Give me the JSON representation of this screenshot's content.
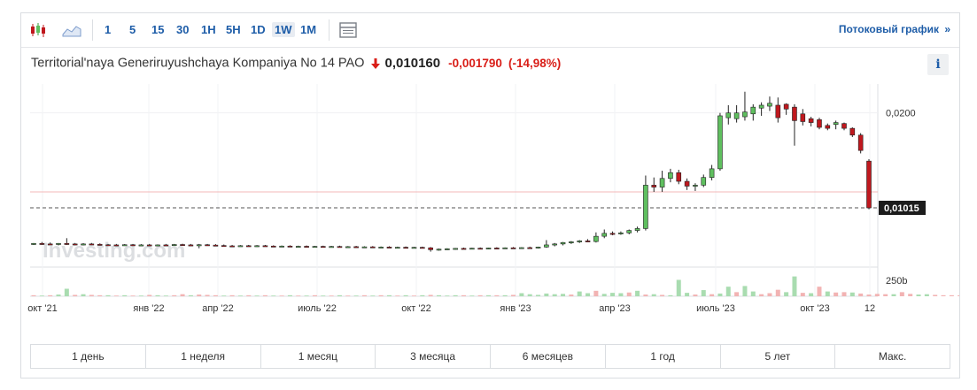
{
  "toolbar": {
    "intervals": [
      "1",
      "5",
      "15",
      "30",
      "1H",
      "5H",
      "1D",
      "1W",
      "1M"
    ],
    "active_interval": "1W",
    "stream_link": "Потоковый график",
    "stream_arrow": "»"
  },
  "header": {
    "instrument": "Territorial'naya Generiruyushchaya Kompaniya No 14 PAO",
    "last_price": "0,010160",
    "change_abs": "-0,001790",
    "change_pct": "(-14,98%)",
    "info_label": "i"
  },
  "chart": {
    "watermark": "Investing.com",
    "price_ticks": [
      "0,0200"
    ],
    "volume_tick": "250b",
    "current_price_label": "0,01015",
    "x_labels": [
      "окт '21",
      "янв '22",
      "апр '22",
      "июль '22",
      "окт '22",
      "янв '23",
      "апр '23",
      "июль '23",
      "окт '23",
      "12"
    ],
    "colors": {
      "up": "#5fbf5f",
      "down": "#c0181e",
      "up_volume": "#a9dcb0",
      "down_volume": "#f2b3b3",
      "price_line": "#c0181e"
    }
  },
  "chart_data": {
    "type": "candlestick",
    "interval": "1W",
    "y_ticks": [
      0.02
    ],
    "last_close": 0.01015,
    "x_tick_labels": [
      "окт '21",
      "янв '22",
      "апр '22",
      "июль '22",
      "окт '22",
      "янв '23",
      "апр '23",
      "июль '23",
      "окт '23",
      "12"
    ],
    "candles": [
      {
        "o": 0.0064,
        "h": 0.0065,
        "l": 0.0063,
        "c": 0.00645
      },
      {
        "o": 0.00645,
        "h": 0.0066,
        "l": 0.0063,
        "c": 0.0064
      },
      {
        "o": 0.0064,
        "h": 0.00655,
        "l": 0.0063,
        "c": 0.00638
      },
      {
        "o": 0.00638,
        "h": 0.0065,
        "l": 0.00625,
        "c": 0.00645
      },
      {
        "o": 0.00645,
        "h": 0.007,
        "l": 0.0063,
        "c": 0.0064
      },
      {
        "o": 0.0064,
        "h": 0.0065,
        "l": 0.00625,
        "c": 0.00635
      },
      {
        "o": 0.00635,
        "h": 0.00648,
        "l": 0.00625,
        "c": 0.0064
      },
      {
        "o": 0.0064,
        "h": 0.0065,
        "l": 0.00628,
        "c": 0.00636
      },
      {
        "o": 0.00636,
        "h": 0.00645,
        "l": 0.00625,
        "c": 0.00632
      },
      {
        "o": 0.00632,
        "h": 0.0064,
        "l": 0.00625,
        "c": 0.0063
      },
      {
        "o": 0.0063,
        "h": 0.0064,
        "l": 0.0062,
        "c": 0.00628
      },
      {
        "o": 0.00628,
        "h": 0.00638,
        "l": 0.0062,
        "c": 0.00632
      },
      {
        "o": 0.00632,
        "h": 0.0064,
        "l": 0.0062,
        "c": 0.00628
      },
      {
        "o": 0.00628,
        "h": 0.00638,
        "l": 0.0062,
        "c": 0.0063
      },
      {
        "o": 0.0063,
        "h": 0.0064,
        "l": 0.0062,
        "c": 0.00625
      },
      {
        "o": 0.00625,
        "h": 0.00635,
        "l": 0.00618,
        "c": 0.0063
      },
      {
        "o": 0.0063,
        "h": 0.0064,
        "l": 0.0062,
        "c": 0.00628
      },
      {
        "o": 0.00628,
        "h": 0.0064,
        "l": 0.0062,
        "c": 0.00634
      },
      {
        "o": 0.00634,
        "h": 0.00642,
        "l": 0.00625,
        "c": 0.0063
      },
      {
        "o": 0.0063,
        "h": 0.0064,
        "l": 0.0062,
        "c": 0.00628
      },
      {
        "o": 0.00628,
        "h": 0.0064,
        "l": 0.00595,
        "c": 0.00632
      },
      {
        "o": 0.00632,
        "h": 0.0064,
        "l": 0.0062,
        "c": 0.00628
      },
      {
        "o": 0.00628,
        "h": 0.00638,
        "l": 0.00618,
        "c": 0.00624
      },
      {
        "o": 0.00624,
        "h": 0.00634,
        "l": 0.00615,
        "c": 0.0062
      },
      {
        "o": 0.0062,
        "h": 0.0063,
        "l": 0.00612,
        "c": 0.00618
      },
      {
        "o": 0.00618,
        "h": 0.00628,
        "l": 0.00612,
        "c": 0.00622
      },
      {
        "o": 0.00622,
        "h": 0.0063,
        "l": 0.00612,
        "c": 0.00618
      },
      {
        "o": 0.00618,
        "h": 0.00628,
        "l": 0.0061,
        "c": 0.00622
      },
      {
        "o": 0.00622,
        "h": 0.0063,
        "l": 0.00612,
        "c": 0.00618
      },
      {
        "o": 0.00618,
        "h": 0.00626,
        "l": 0.0061,
        "c": 0.00615
      },
      {
        "o": 0.00615,
        "h": 0.00624,
        "l": 0.00608,
        "c": 0.00618
      },
      {
        "o": 0.00618,
        "h": 0.00626,
        "l": 0.0061,
        "c": 0.00614
      },
      {
        "o": 0.00614,
        "h": 0.00622,
        "l": 0.00606,
        "c": 0.00616
      },
      {
        "o": 0.00616,
        "h": 0.00624,
        "l": 0.00608,
        "c": 0.00612
      },
      {
        "o": 0.00612,
        "h": 0.0062,
        "l": 0.00606,
        "c": 0.00615
      },
      {
        "o": 0.00615,
        "h": 0.00622,
        "l": 0.00608,
        "c": 0.00612
      },
      {
        "o": 0.00612,
        "h": 0.0062,
        "l": 0.00605,
        "c": 0.00614
      },
      {
        "o": 0.00614,
        "h": 0.00622,
        "l": 0.00606,
        "c": 0.0061
      },
      {
        "o": 0.0061,
        "h": 0.00618,
        "l": 0.00604,
        "c": 0.00612
      },
      {
        "o": 0.00612,
        "h": 0.0062,
        "l": 0.00604,
        "c": 0.00608
      },
      {
        "o": 0.00608,
        "h": 0.00616,
        "l": 0.006,
        "c": 0.0061
      },
      {
        "o": 0.0061,
        "h": 0.00618,
        "l": 0.00602,
        "c": 0.00606
      },
      {
        "o": 0.00606,
        "h": 0.00614,
        "l": 0.00598,
        "c": 0.00608
      },
      {
        "o": 0.00608,
        "h": 0.00616,
        "l": 0.006,
        "c": 0.00604
      },
      {
        "o": 0.00604,
        "h": 0.00612,
        "l": 0.00596,
        "c": 0.00606
      },
      {
        "o": 0.00606,
        "h": 0.00614,
        "l": 0.00598,
        "c": 0.00603
      },
      {
        "o": 0.00603,
        "h": 0.0061,
        "l": 0.00596,
        "c": 0.00605
      },
      {
        "o": 0.00605,
        "h": 0.00612,
        "l": 0.00598,
        "c": 0.006
      },
      {
        "o": 0.006,
        "h": 0.00608,
        "l": 0.0056,
        "c": 0.0058
      },
      {
        "o": 0.0058,
        "h": 0.00592,
        "l": 0.0057,
        "c": 0.00586
      },
      {
        "o": 0.00586,
        "h": 0.00596,
        "l": 0.00576,
        "c": 0.0059
      },
      {
        "o": 0.0059,
        "h": 0.00598,
        "l": 0.0058,
        "c": 0.00594
      },
      {
        "o": 0.00594,
        "h": 0.00602,
        "l": 0.00586,
        "c": 0.00592
      },
      {
        "o": 0.00592,
        "h": 0.006,
        "l": 0.00584,
        "c": 0.00596
      },
      {
        "o": 0.00596,
        "h": 0.00604,
        "l": 0.00588,
        "c": 0.00594
      },
      {
        "o": 0.00594,
        "h": 0.00602,
        "l": 0.00586,
        "c": 0.00598
      },
      {
        "o": 0.00598,
        "h": 0.00606,
        "l": 0.0059,
        "c": 0.00596
      },
      {
        "o": 0.00596,
        "h": 0.00604,
        "l": 0.00588,
        "c": 0.006
      },
      {
        "o": 0.006,
        "h": 0.00608,
        "l": 0.00592,
        "c": 0.00598
      },
      {
        "o": 0.00598,
        "h": 0.00606,
        "l": 0.0059,
        "c": 0.00602
      },
      {
        "o": 0.00602,
        "h": 0.00612,
        "l": 0.00594,
        "c": 0.006
      },
      {
        "o": 0.006,
        "h": 0.00612,
        "l": 0.00592,
        "c": 0.00608
      },
      {
        "o": 0.00608,
        "h": 0.0068,
        "l": 0.006,
        "c": 0.0063
      },
      {
        "o": 0.0063,
        "h": 0.0065,
        "l": 0.00615,
        "c": 0.0064
      },
      {
        "o": 0.0064,
        "h": 0.0066,
        "l": 0.00625,
        "c": 0.00655
      },
      {
        "o": 0.00655,
        "h": 0.0067,
        "l": 0.0064,
        "c": 0.00662
      },
      {
        "o": 0.00662,
        "h": 0.0068,
        "l": 0.0065,
        "c": 0.00672
      },
      {
        "o": 0.00672,
        "h": 0.0069,
        "l": 0.00658,
        "c": 0.00665
      },
      {
        "o": 0.00665,
        "h": 0.0076,
        "l": 0.00655,
        "c": 0.0072
      },
      {
        "o": 0.0072,
        "h": 0.0079,
        "l": 0.007,
        "c": 0.0075
      },
      {
        "o": 0.0075,
        "h": 0.0077,
        "l": 0.0073,
        "c": 0.00745
      },
      {
        "o": 0.00745,
        "h": 0.0077,
        "l": 0.00735,
        "c": 0.00755
      },
      {
        "o": 0.00755,
        "h": 0.0079,
        "l": 0.0074,
        "c": 0.0078
      },
      {
        "o": 0.0078,
        "h": 0.0082,
        "l": 0.0076,
        "c": 0.008
      },
      {
        "o": 0.008,
        "h": 0.0135,
        "l": 0.0078,
        "c": 0.0125
      },
      {
        "o": 0.0125,
        "h": 0.0133,
        "l": 0.0118,
        "c": 0.0123
      },
      {
        "o": 0.0123,
        "h": 0.014,
        "l": 0.0118,
        "c": 0.0132
      },
      {
        "o": 0.0132,
        "h": 0.0142,
        "l": 0.0128,
        "c": 0.0138
      },
      {
        "o": 0.0138,
        "h": 0.0141,
        "l": 0.0126,
        "c": 0.0129
      },
      {
        "o": 0.0129,
        "h": 0.0132,
        "l": 0.012,
        "c": 0.0124
      },
      {
        "o": 0.0124,
        "h": 0.0127,
        "l": 0.0119,
        "c": 0.0125
      },
      {
        "o": 0.0125,
        "h": 0.0136,
        "l": 0.0123,
        "c": 0.0133
      },
      {
        "o": 0.0133,
        "h": 0.0146,
        "l": 0.013,
        "c": 0.0142
      },
      {
        "o": 0.0142,
        "h": 0.02,
        "l": 0.014,
        "c": 0.0197
      },
      {
        "o": 0.0195,
        "h": 0.0208,
        "l": 0.0188,
        "c": 0.02
      },
      {
        "o": 0.0194,
        "h": 0.0208,
        "l": 0.019,
        "c": 0.02
      },
      {
        "o": 0.0196,
        "h": 0.0222,
        "l": 0.0192,
        "c": 0.0201
      },
      {
        "o": 0.0199,
        "h": 0.0209,
        "l": 0.0192,
        "c": 0.0206
      },
      {
        "o": 0.0205,
        "h": 0.0211,
        "l": 0.0197,
        "c": 0.0208
      },
      {
        "o": 0.0207,
        "h": 0.0217,
        "l": 0.0202,
        "c": 0.021
      },
      {
        "o": 0.0208,
        "h": 0.0216,
        "l": 0.019,
        "c": 0.0195
      },
      {
        "o": 0.0209,
        "h": 0.021,
        "l": 0.0198,
        "c": 0.0204
      },
      {
        "o": 0.0206,
        "h": 0.0209,
        "l": 0.0166,
        "c": 0.0192
      },
      {
        "o": 0.0199,
        "h": 0.0204,
        "l": 0.0187,
        "c": 0.0191
      },
      {
        "o": 0.0194,
        "h": 0.0196,
        "l": 0.0186,
        "c": 0.019
      },
      {
        "o": 0.0193,
        "h": 0.0195,
        "l": 0.0183,
        "c": 0.0185
      },
      {
        "o": 0.0187,
        "h": 0.0189,
        "l": 0.0182,
        "c": 0.0184
      },
      {
        "o": 0.0188,
        "h": 0.0192,
        "l": 0.0183,
        "c": 0.019
      },
      {
        "o": 0.0189,
        "h": 0.019,
        "l": 0.0182,
        "c": 0.0184
      },
      {
        "o": 0.0184,
        "h": 0.0185,
        "l": 0.0175,
        "c": 0.0177
      },
      {
        "o": 0.0177,
        "h": 0.0179,
        "l": 0.0158,
        "c": 0.0161
      },
      {
        "o": 0.015,
        "h": 0.0152,
        "l": 0.01,
        "c": 0.01015
      }
    ],
    "volumes": [
      3,
      2,
      3,
      5,
      22,
      4,
      6,
      4,
      3,
      3,
      2,
      3,
      2,
      2,
      4,
      3,
      2,
      3,
      6,
      3,
      5,
      4,
      3,
      2,
      3,
      2,
      3,
      2,
      3,
      2,
      2,
      3,
      2,
      2,
      3,
      2,
      2,
      3,
      2,
      2,
      3,
      2,
      3,
      3,
      2,
      3,
      2,
      3,
      4,
      3,
      2,
      3,
      3,
      2,
      3,
      3,
      3,
      3,
      4,
      9,
      6,
      4,
      8,
      6,
      7,
      5,
      14,
      9,
      16,
      7,
      10,
      9,
      11,
      16,
      5,
      6,
      4,
      3,
      48,
      10,
      5,
      18,
      6,
      8,
      28,
      12,
      30,
      14,
      6,
      9,
      19,
      12,
      58,
      10,
      9,
      28,
      14,
      11,
      12,
      11,
      8,
      5,
      7,
      6,
      6,
      12,
      7,
      5,
      6,
      4,
      3,
      3,
      3,
      4,
      3
    ],
    "volume_up": [
      false,
      true,
      false,
      true,
      true,
      false,
      true,
      false,
      false,
      true,
      false,
      true,
      false,
      true,
      false,
      true,
      true,
      false,
      false,
      true,
      false,
      false,
      false,
      true,
      false,
      true,
      false,
      true,
      false,
      true,
      false,
      true,
      false,
      true,
      false,
      true,
      false,
      true,
      false,
      true,
      false,
      true,
      false,
      true,
      false,
      true,
      false,
      true,
      false,
      true,
      true,
      true,
      false,
      true,
      false,
      true,
      false,
      true,
      false,
      true,
      true,
      true,
      true,
      true,
      true,
      false,
      true,
      true,
      false,
      true,
      true,
      true,
      false,
      true,
      false,
      true,
      false,
      true,
      true,
      true,
      false,
      true,
      false,
      true,
      true,
      false,
      true,
      true,
      false,
      false,
      false,
      true,
      true,
      false,
      true,
      false,
      true,
      false,
      false,
      true,
      false,
      false,
      false,
      false,
      true,
      false,
      false,
      true,
      true,
      false,
      false,
      false,
      false,
      true,
      false
    ],
    "volume_ticks": [
      "250b"
    ]
  },
  "range_buttons": [
    "1 день",
    "1 неделя",
    "1 месяц",
    "3 месяца",
    "6 месяцев",
    "1 год",
    "5 лет",
    "Макс."
  ]
}
